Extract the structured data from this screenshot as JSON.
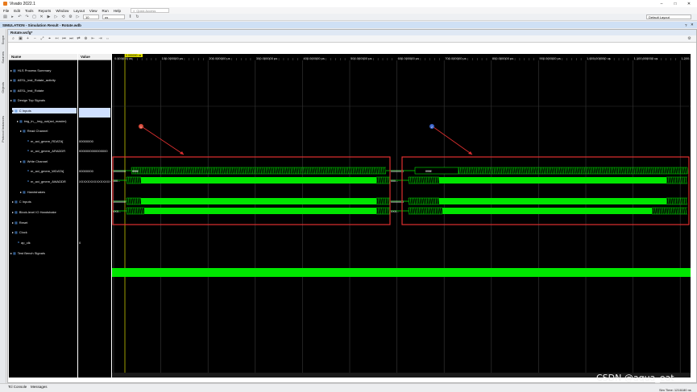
{
  "titlebar": {
    "title": "Vivado 2022.1"
  },
  "menu": [
    "File",
    "Edit",
    "Tools",
    "Reports",
    "Window",
    "Layout",
    "View",
    "Run",
    "Help"
  ],
  "quick_access": "Quick Access",
  "toolbar": {
    "run_time": "10",
    "unit": "us",
    "layout": "Default Layout"
  },
  "sim_banner": "SIMULATION - Simulation Result - Rotate.wdb",
  "side_tabs": [
    "Scope",
    "Sources",
    "Objects",
    "Protocol Instances"
  ],
  "panel_title": "Rotate.wcfg*",
  "columns": {
    "name": "Name",
    "value": "Value"
  },
  "signals": [
    {
      "name": "HLS Process Summary",
      "value": ""
    },
    {
      "name": "AESL_inst_Rotate_activity",
      "value": ""
    },
    {
      "name": "AESL_inst_Rotate",
      "value": ""
    },
    {
      "name": "Design Top Signals",
      "value": ""
    },
    {
      "name": "C Inputs",
      "value": ""
    },
    {
      "name": "img_in__img_out(axi_master)",
      "value": ""
    },
    {
      "name": "Read Channel",
      "value": ""
    },
    {
      "name": "m_axi_gmem_RDATA[",
      "value": "00000000"
    },
    {
      "name": "m_axi_gmem_ARADDR",
      "value": "0000000000000000"
    },
    {
      "name": "Write Channel",
      "value": ""
    },
    {
      "name": "m_axi_gmem_WDATA[",
      "value": "00000000"
    },
    {
      "name": "m_axi_gmem_AWADDR",
      "value": "XXXXXXXXXXXXXXXX"
    },
    {
      "name": "Handshakes",
      "value": ""
    },
    {
      "name": "C Inputs",
      "value": ""
    },
    {
      "name": "Block-level IO Handshake",
      "value": ""
    },
    {
      "name": "Reset",
      "value": ""
    },
    {
      "name": "Clock",
      "value": ""
    },
    {
      "name": "ap_clk",
      "value": "0"
    },
    {
      "name": "Test Bench Signals",
      "value": ""
    }
  ],
  "ruler": {
    "cursor": "0.000000 us",
    "ticks": [
      "0.000000 us",
      "100.000000 us",
      "200.000000 us",
      "300.000000 us",
      "400.000000 us",
      "500.000000 us",
      "600.000000 us",
      "700.000000 us",
      "800.000000 us",
      "900.000000 us",
      "1,000.000000 us",
      "1,100.000000 us",
      "1,200"
    ]
  },
  "wave_labels": {
    "rdata_left": "00000000",
    "rdata_mid1": "ffffffff",
    "rdata_right": "00000000",
    "rdata_right2": "ffffffff",
    "araddr_left": "000...",
    "araddr_right": "000...",
    "wdata_left": "00000000",
    "wdata_right": "00000000",
    "awaddr_left": "XXX...",
    "awaddr_right": "XXX..."
  },
  "markers": [
    "1",
    "2"
  ],
  "bottom_tabs": [
    "Tcl Console",
    "Messages"
  ],
  "sim_time": "Sim Time: 1216180 ns",
  "watermark": "CSDN @aqua_eat",
  "colors": {
    "wave": "#00e600",
    "highlight": "#e03030",
    "select": "#cfe0ff"
  }
}
